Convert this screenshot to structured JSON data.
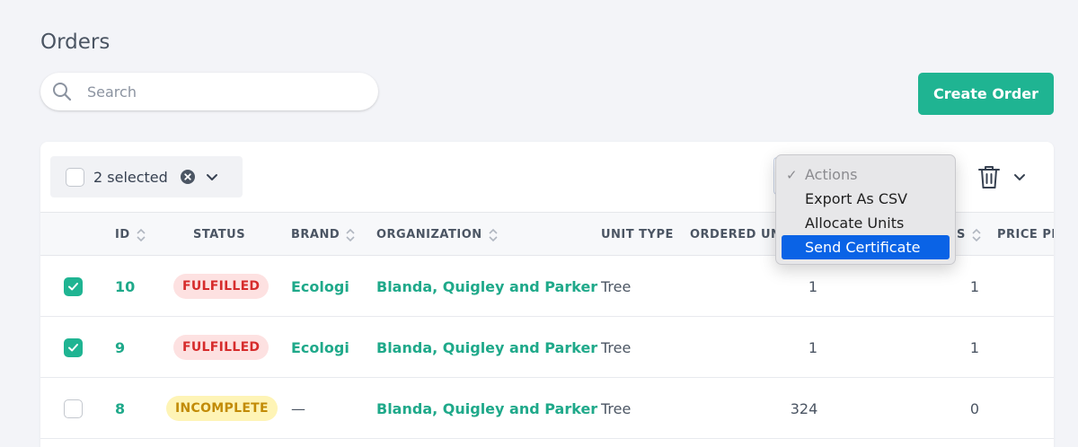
{
  "page": {
    "title": "Orders"
  },
  "search": {
    "placeholder": "Search",
    "value": ""
  },
  "create_button": {
    "label": "Create Order"
  },
  "selection": {
    "label": "2 selected"
  },
  "actions_menu": {
    "header": "Actions",
    "check_mark": "✓",
    "items": [
      "Export As CSV",
      "Allocate Units",
      "Send Certificate"
    ],
    "highlighted": "Send Certificate"
  },
  "table": {
    "columns": [
      "ID",
      "STATUS",
      "BRAND",
      "ORGANIZATION",
      "UNIT TYPE",
      "ORDERED UN",
      "S",
      "PRICE PE"
    ],
    "rows": [
      {
        "checked": true,
        "id": "10",
        "status": "FULFILLED",
        "brand": "Ecologi",
        "organization": "Blanda, Quigley and Parker",
        "unit_type": "Tree",
        "ordered_units": "1",
        "col7": "1"
      },
      {
        "checked": true,
        "id": "9",
        "status": "FULFILLED",
        "brand": "Ecologi",
        "organization": "Blanda, Quigley and Parker",
        "unit_type": "Tree",
        "ordered_units": "1",
        "col7": "1"
      },
      {
        "checked": false,
        "id": "8",
        "status": "INCOMPLETE",
        "brand": "—",
        "organization": "Blanda, Quigley and Parker",
        "unit_type": "Tree",
        "ordered_units": "324",
        "col7": "0"
      }
    ]
  },
  "colors": {
    "accent": "#1fb492",
    "fulfilled": "#d62c2c",
    "incomplete": "#c28b07",
    "highlight": "#0a63e6"
  },
  "icons": [
    "search-icon",
    "clear-icon",
    "chevron-down-icon",
    "trash-icon",
    "sort-icon",
    "check-icon"
  ]
}
